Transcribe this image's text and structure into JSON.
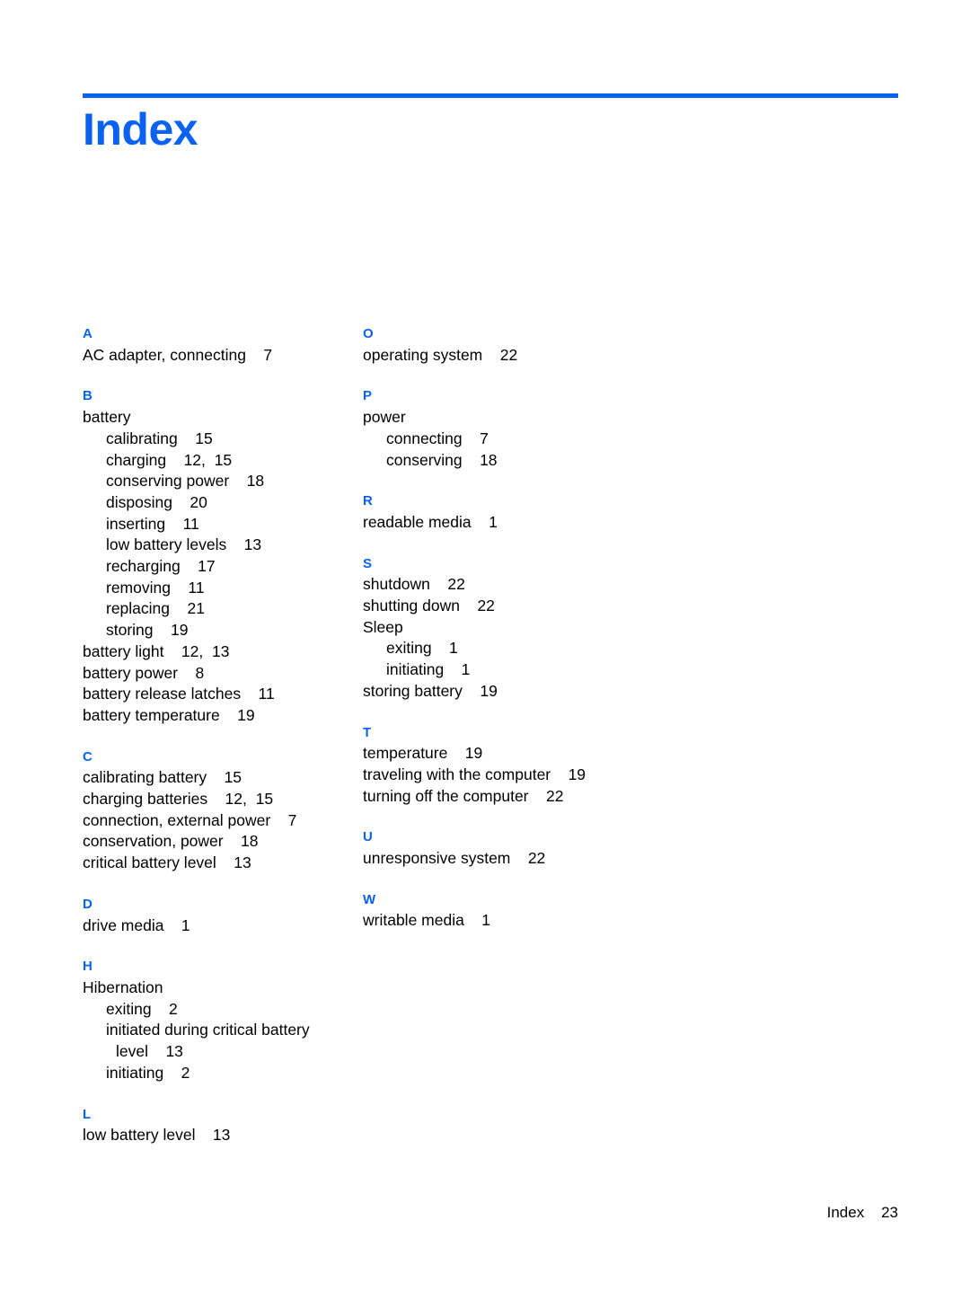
{
  "document": {
    "title": "Index",
    "accent_color": "#0b61f0",
    "footer": "Index    23"
  },
  "columns": [
    {
      "name": "left",
      "sections": [
        {
          "letter": "A",
          "entries": [
            {
              "level": 1,
              "text": "AC adapter, connecting    7"
            }
          ]
        },
        {
          "letter": "B",
          "entries": [
            {
              "level": 1,
              "text": "battery"
            },
            {
              "level": 2,
              "text": "calibrating    15"
            },
            {
              "level": 2,
              "text": "charging    12,  15"
            },
            {
              "level": 2,
              "text": "conserving power    18"
            },
            {
              "level": 2,
              "text": "disposing    20"
            },
            {
              "level": 2,
              "text": "inserting    11"
            },
            {
              "level": 2,
              "text": "low battery levels    13"
            },
            {
              "level": 2,
              "text": "recharging    17"
            },
            {
              "level": 2,
              "text": "removing    11"
            },
            {
              "level": 2,
              "text": "replacing    21"
            },
            {
              "level": 2,
              "text": "storing    19"
            },
            {
              "level": 1,
              "text": "battery light    12,  13"
            },
            {
              "level": 1,
              "text": "battery power    8"
            },
            {
              "level": 1,
              "text": "battery release latches    11"
            },
            {
              "level": 1,
              "text": "battery temperature    19"
            }
          ]
        },
        {
          "letter": "C",
          "entries": [
            {
              "level": 1,
              "text": "calibrating battery    15"
            },
            {
              "level": 1,
              "text": "charging batteries    12,  15"
            },
            {
              "level": 1,
              "text": "connection, external power    7"
            },
            {
              "level": 1,
              "text": "conservation, power    18"
            },
            {
              "level": 1,
              "text": "critical battery level    13"
            }
          ]
        },
        {
          "letter": "D",
          "entries": [
            {
              "level": 1,
              "text": "drive media    1"
            }
          ]
        },
        {
          "letter": "H",
          "entries": [
            {
              "level": 1,
              "text": "Hibernation"
            },
            {
              "level": 2,
              "text": "exiting    2"
            },
            {
              "level": 2,
              "text": "initiated during critical battery"
            },
            {
              "level": 3,
              "text": "level    13"
            },
            {
              "level": 2,
              "text": "initiating    2"
            }
          ]
        },
        {
          "letter": "L",
          "entries": [
            {
              "level": 1,
              "text": "low battery level    13"
            }
          ]
        }
      ]
    },
    {
      "name": "right",
      "sections": [
        {
          "letter": "O",
          "entries": [
            {
              "level": 1,
              "text": "operating system    22"
            }
          ]
        },
        {
          "letter": "P",
          "entries": [
            {
              "level": 1,
              "text": "power"
            },
            {
              "level": 2,
              "text": "connecting    7"
            },
            {
              "level": 2,
              "text": "conserving    18"
            }
          ]
        },
        {
          "letter": "R",
          "entries": [
            {
              "level": 1,
              "text": "readable media    1"
            }
          ]
        },
        {
          "letter": "S",
          "entries": [
            {
              "level": 1,
              "text": "shutdown    22"
            },
            {
              "level": 1,
              "text": "shutting down    22"
            },
            {
              "level": 1,
              "text": "Sleep"
            },
            {
              "level": 2,
              "text": "exiting    1"
            },
            {
              "level": 2,
              "text": "initiating    1"
            },
            {
              "level": 1,
              "text": "storing battery    19"
            }
          ]
        },
        {
          "letter": "T",
          "entries": [
            {
              "level": 1,
              "text": "temperature    19"
            },
            {
              "level": 1,
              "text": "traveling with the computer    19"
            },
            {
              "level": 1,
              "text": "turning off the computer    22"
            }
          ]
        },
        {
          "letter": "U",
          "entries": [
            {
              "level": 1,
              "text": "unresponsive system    22"
            }
          ]
        },
        {
          "letter": "W",
          "entries": [
            {
              "level": 1,
              "text": "writable media    1"
            }
          ]
        }
      ]
    }
  ]
}
